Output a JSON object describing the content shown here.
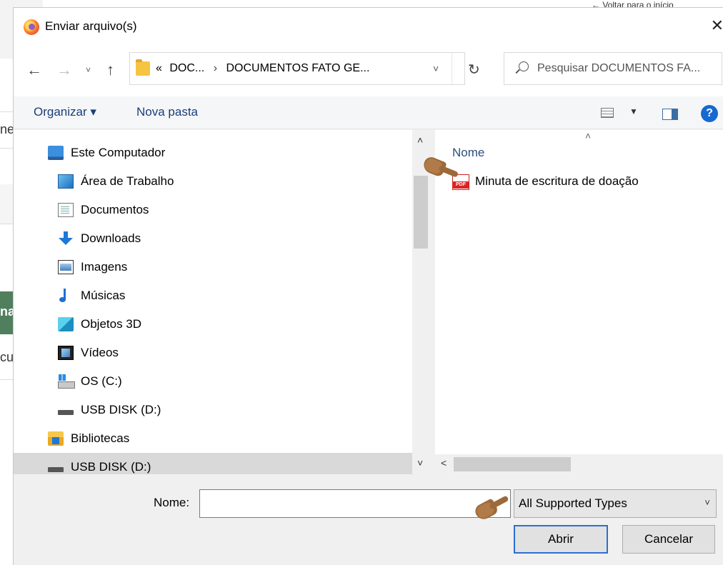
{
  "background": {
    "top_right_text": "← Voltar para o início",
    "fragments": [
      "ne",
      "",
      "na",
      "cu"
    ]
  },
  "dialog": {
    "title": "Enviar arquivo(s)",
    "close_glyph": "✕",
    "nav": {
      "back_glyph": "←",
      "forward_glyph": "→",
      "history_glyph": "˅",
      "up_glyph": "↑",
      "refresh_glyph": "↻"
    },
    "address": {
      "prefix": "«",
      "segments": [
        "DOC...",
        "DOCUMENTOS FATO GE..."
      ],
      "separator": "›",
      "dropdown_glyph": "˅"
    },
    "search": {
      "placeholder": "Pesquisar DOCUMENTOS FA..."
    },
    "toolbar": {
      "organize": "Organizar ▾",
      "new_folder": "Nova pasta",
      "help": "?"
    },
    "tree": [
      {
        "label": "Este Computador",
        "icon": "computer-icon"
      },
      {
        "label": "Área de Trabalho",
        "icon": "desktop-icon"
      },
      {
        "label": "Documentos",
        "icon": "documents-icon"
      },
      {
        "label": "Downloads",
        "icon": "downloads-icon"
      },
      {
        "label": "Imagens",
        "icon": "pictures-icon"
      },
      {
        "label": "Músicas",
        "icon": "music-icon"
      },
      {
        "label": "Objetos 3D",
        "icon": "3d-objects-icon"
      },
      {
        "label": "Vídeos",
        "icon": "videos-icon"
      },
      {
        "label": "OS (C:)",
        "icon": "drive-icon"
      },
      {
        "label": "USB DISK (D:)",
        "icon": "usb-drive-icon"
      },
      {
        "label": "Bibliotecas",
        "icon": "libraries-icon"
      },
      {
        "label": "USB DISK (D:)",
        "icon": "usb-drive-icon",
        "selected": true
      }
    ],
    "file_list": {
      "column_name": "Nome",
      "sort_glyph": "˄",
      "files": [
        {
          "name": "Minuta de escritura de doação",
          "icon": "pdf-file-icon",
          "icon_text": "PDF"
        }
      ]
    },
    "footer": {
      "name_label": "Nome:",
      "name_value": "",
      "file_type": "All Supported Types",
      "open_button": "Abrir",
      "cancel_button": "Cancelar"
    }
  }
}
